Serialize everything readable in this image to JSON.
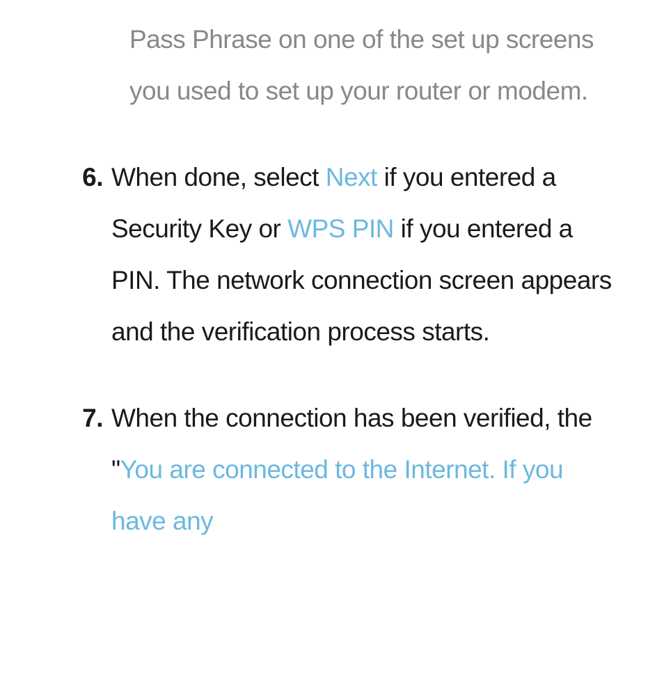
{
  "note": {
    "text": "Pass Phrase on one of the set up screens you used to set up your router or modem."
  },
  "steps": {
    "step6": {
      "number": "6.",
      "part1": "When done, select ",
      "highlight1": "Next",
      "part2": " if you entered a Security Key or ",
      "highlight2": "WPS PIN",
      "part3": " if you entered a PIN. The network connection screen appears and the verification process starts."
    },
    "step7": {
      "number": "7.",
      "part1": " When the connection has been verified, the \"",
      "highlight1": "You are connected to the Internet. If you have any"
    }
  }
}
